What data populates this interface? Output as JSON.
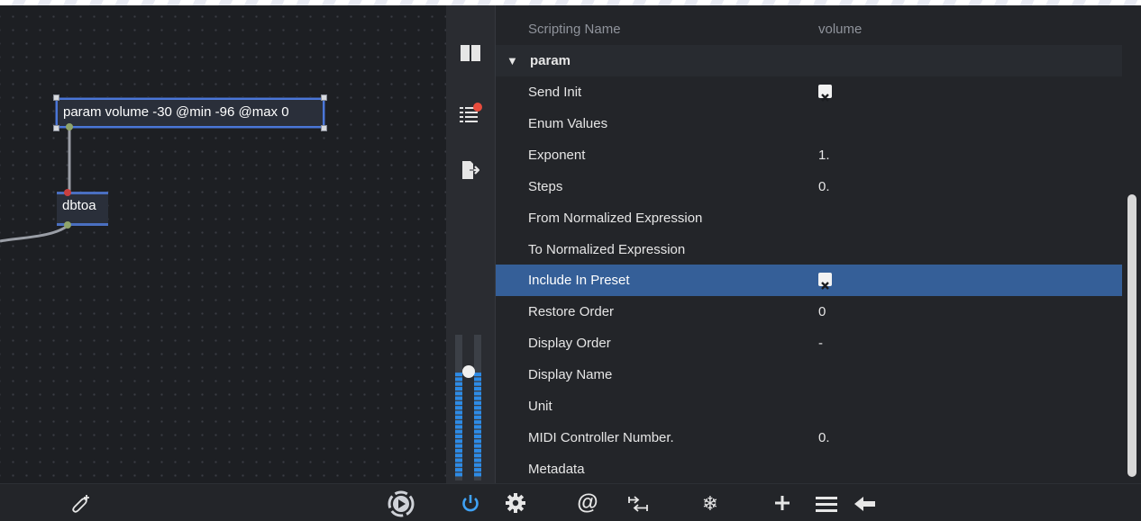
{
  "patcher": {
    "objects": {
      "param_text": "param volume -30 @min -96 @max 0",
      "dbtoa_text": "dbtoa"
    }
  },
  "sidebar": {
    "icons": [
      "split-view-icon",
      "list-notification-icon",
      "export-icon"
    ],
    "meter_level": 0.74
  },
  "inspector": {
    "header": {
      "key": "Scripting Name",
      "value": "volume"
    },
    "section_title": "param",
    "rows": [
      {
        "key": "Send Init",
        "value": "",
        "checkbox": true
      },
      {
        "key": "Enum Values",
        "value": ""
      },
      {
        "key": "Exponent",
        "value": "1."
      },
      {
        "key": "Steps",
        "value": "0."
      },
      {
        "key": "From Normalized Expression",
        "value": ""
      },
      {
        "key": "To Normalized Expression",
        "value": ""
      },
      {
        "key": "Include In Preset",
        "value": "",
        "checkbox": true,
        "selected": true
      },
      {
        "key": "Restore Order",
        "value": "0"
      },
      {
        "key": "Display Order",
        "value": "-"
      },
      {
        "key": "Display Name",
        "value": ""
      },
      {
        "key": "Unit",
        "value": ""
      },
      {
        "key": "MIDI Controller Number.",
        "value": "0."
      },
      {
        "key": "Metadata",
        "value": ""
      }
    ]
  },
  "toolbar": {
    "patcher": [
      "add-clip-icon",
      "play-icon"
    ],
    "inspector": [
      "gear-icon",
      "at-icon",
      "transform-icon",
      "freeze-icon",
      "plus-icon",
      "menu-icon",
      "back-arrow-icon"
    ]
  },
  "colors": {
    "selection": "#355f98",
    "object_border": "#4a6fc1",
    "inlet": "#c93f3f",
    "outlet": "#8fa46a",
    "meter": "#2d8be6",
    "power": "#3fa2f5",
    "notification": "#e84c3d"
  }
}
